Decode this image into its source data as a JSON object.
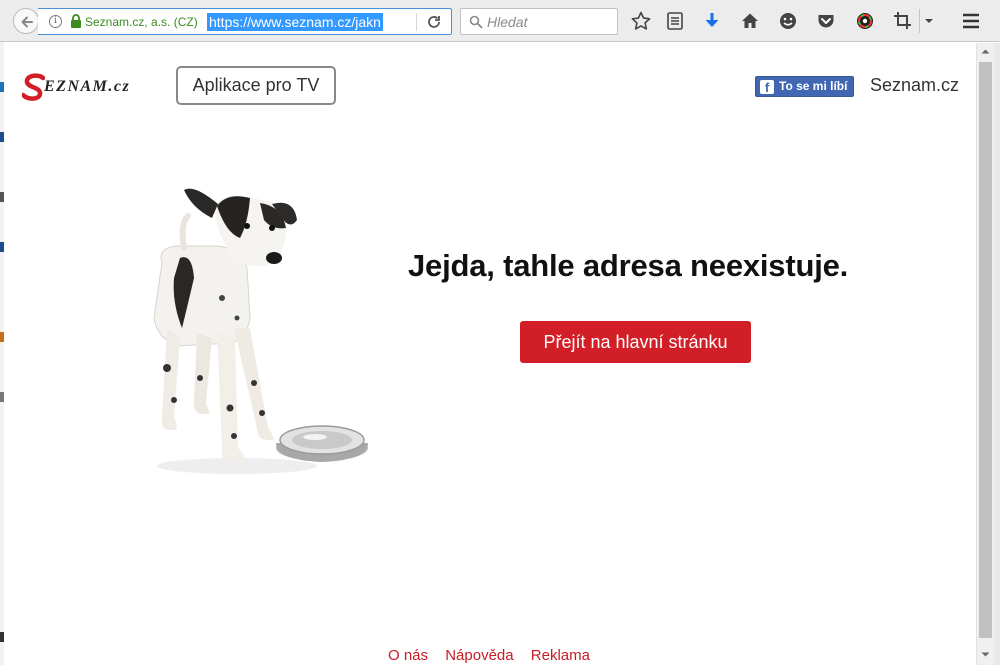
{
  "browser": {
    "identity": "Seznam.cz, a.s. (CZ)",
    "url": "https://www.seznam.cz/jakn",
    "search_placeholder": "Hledat"
  },
  "header": {
    "logo_text": "Seznam.cz",
    "tv_button": "Aplikace pro TV",
    "fb_like": "To se mi líbí",
    "seznam_link": "Seznam.cz"
  },
  "main": {
    "headline": "Jejda, tahle adresa neexistuje.",
    "home_button": "Přejít na hlavní stránku"
  },
  "footer": {
    "links": [
      "O nás",
      "Nápověda",
      "Reklama"
    ]
  },
  "colors": {
    "accent_red": "#d21e26",
    "facebook_blue": "#4267b2",
    "secure_green": "#3c8c1f",
    "link_red": "#c51d26"
  }
}
